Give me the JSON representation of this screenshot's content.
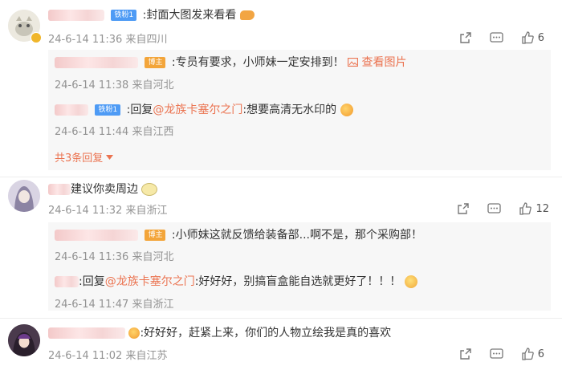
{
  "comments": [
    {
      "text": ":封面大图发来看看",
      "badge": "铁粉1",
      "meta": "24-6-14 11:36 来自四川",
      "likes": "6",
      "replies": [
        {
          "badge": "博主",
          "text": ":专员有要求，小师妹一定安排到！",
          "link": "查看图片",
          "meta": "24-6-14 11:38 来自河北"
        },
        {
          "badge": "铁粉1",
          "prefix": ":回复",
          "mention": "@龙族卡塞尔之门",
          "text": ":想要高清无水印的",
          "meta": "24-6-14 11:44 来自江西"
        }
      ],
      "more": "共3条回复"
    },
    {
      "text": "建议你卖周边",
      "meta": "24-6-14 11:32 来自浙江",
      "likes": "12",
      "replies": [
        {
          "badge": "博主",
          "text": ":小师妹这就反馈给装备部...啊不是，那个采购部！",
          "meta": "24-6-14 11:36 来自河北"
        },
        {
          "prefix": ":回复",
          "mention": "@龙族卡塞尔之门",
          "text": ":好好好，别搞盲盒能自选就更好了！！！",
          "meta": "24-6-14 11:47 来自浙江"
        }
      ]
    },
    {
      "text": ":好好好，赶紧上来，你们的人物立绘我是真的喜欢",
      "meta": "24-6-14 11:02 来自江苏",
      "likes": "6"
    }
  ],
  "colors": {
    "link": "#eb7350",
    "meta": "#939393",
    "reply_bg": "#f7f7f7"
  },
  "icons": [
    "share-icon",
    "comment-icon",
    "like-icon",
    "chevron-down-icon"
  ]
}
